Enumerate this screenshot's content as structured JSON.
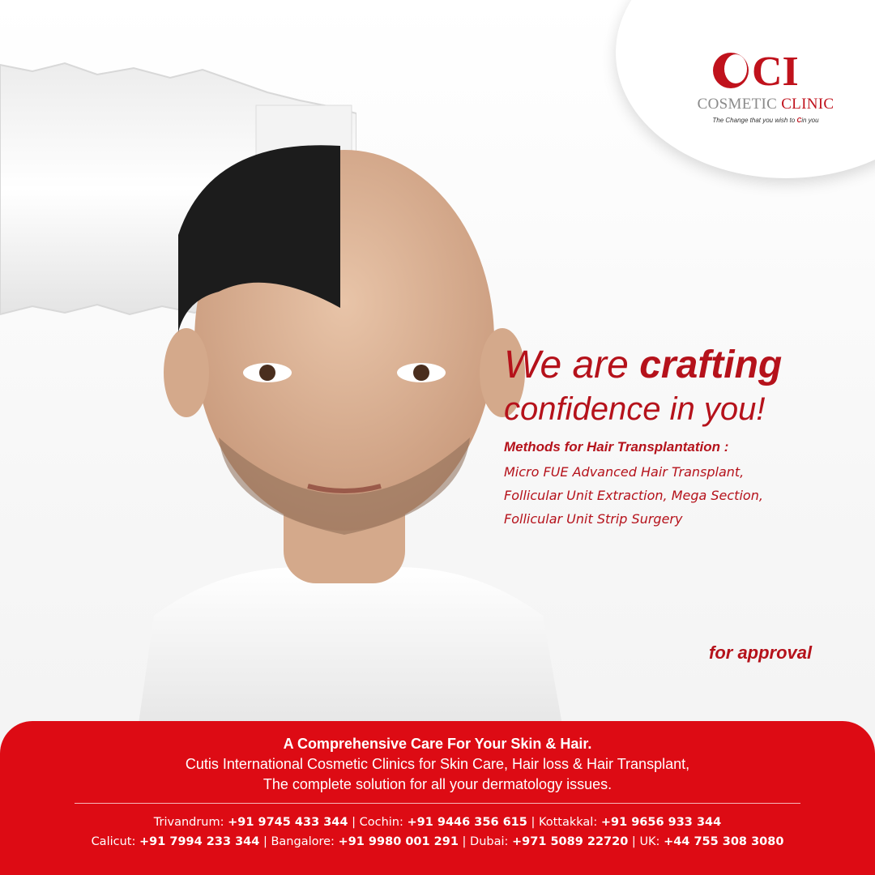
{
  "logo": {
    "mark": "CI",
    "name_part1": "COSMETIC",
    "name_part2": "CLINIC",
    "tagline_before": "The Change that you wish to ",
    "tagline_c": "C",
    "tagline_after": "in you"
  },
  "headline": {
    "line1_prefix": "We are ",
    "line1_bold": "crafting",
    "line2": "confidence in you!"
  },
  "methods": {
    "title": "Methods for Hair Transplantation :",
    "line1": "Micro FUE Advanced Hair Transplant,",
    "line2": "Follicular Unit Extraction, Mega Section,",
    "line3": "Follicular Unit Strip Surgery"
  },
  "approval": "for approval",
  "footer": {
    "title": "A Comprehensive Care For Your Skin & Hair.",
    "line1": "Cutis International Cosmetic Clinics for Skin Care, Hair loss & Hair Transplant,",
    "line2": "The complete solution for all your dermatology issues.",
    "contacts_row1": [
      {
        "city": "Trivandrum:",
        "phone": "+91 9745 433 344"
      },
      {
        "city": "Cochin:",
        "phone": "+91 9446 356 615"
      },
      {
        "city": "Kottakkal:",
        "phone": "+91 9656 933 344"
      }
    ],
    "contacts_row2": [
      {
        "city": "Calicut:",
        "phone": "+91 7994 233 344"
      },
      {
        "city": "Bangalore:",
        "phone": "+91 9980 001 291"
      },
      {
        "city": "Dubai:",
        "phone": "+971 5089 22720"
      },
      {
        "city": "UK:",
        "phone": "+44 755 308 3080"
      }
    ]
  },
  "colors": {
    "brand_red": "#dd0b14",
    "text_red": "#b5121b",
    "logo_grey": "#8a8a8a"
  }
}
